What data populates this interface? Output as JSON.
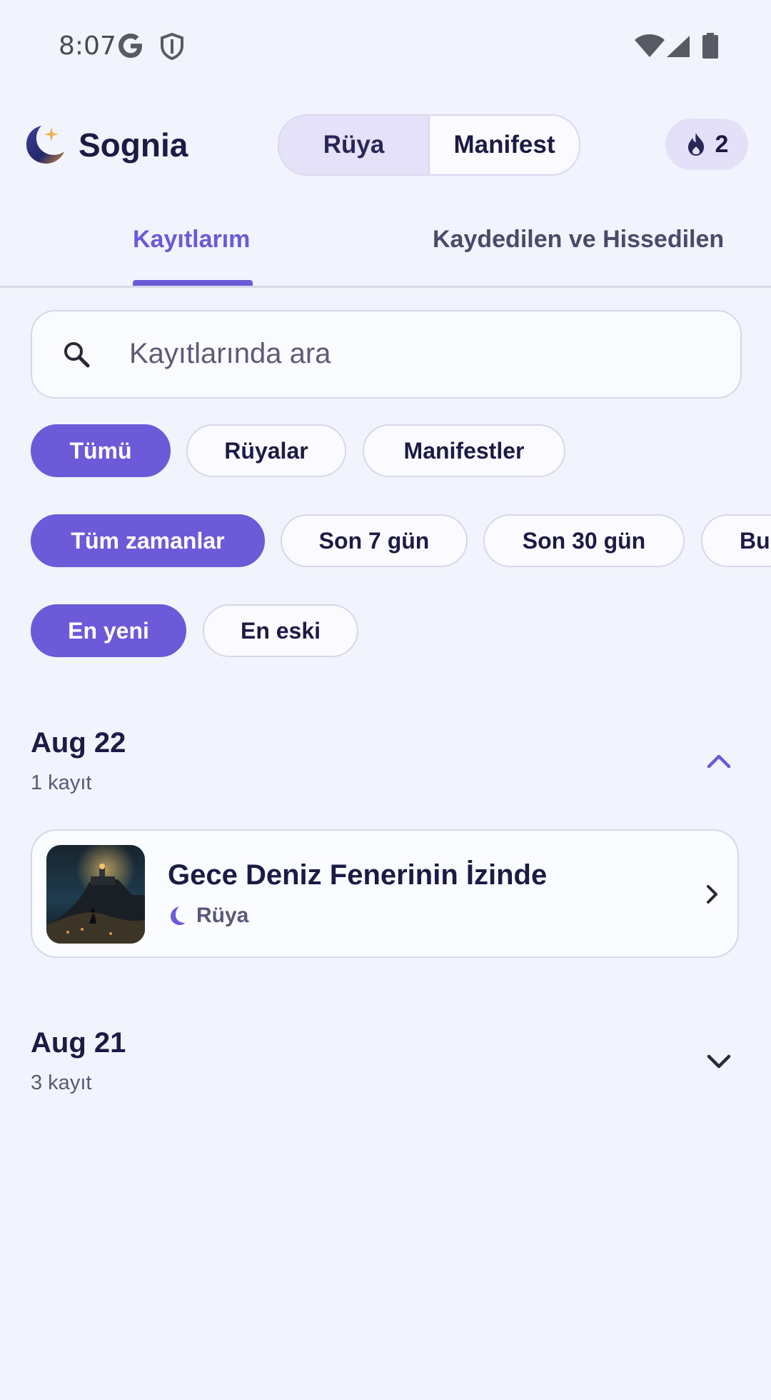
{
  "status_bar": {
    "time": "8:07",
    "icons": [
      "google-icon",
      "shield-icon",
      "wifi-icon",
      "cellular-icon",
      "battery-icon"
    ]
  },
  "header": {
    "title": "Sognia",
    "logo": "moon-star-logo",
    "mode_toggle": {
      "options": [
        "Rüya",
        "Manifest"
      ],
      "selected": "Rüya"
    },
    "streak": {
      "icon": "flame-icon",
      "count": "2"
    }
  },
  "tabs": [
    {
      "label": "Kayıtlarım",
      "active": true
    },
    {
      "label": "Kaydedilen ve Hissedilen",
      "active": false
    }
  ],
  "search": {
    "placeholder": "Kayıtlarında ara",
    "value": ""
  },
  "filters": {
    "type": [
      {
        "label": "Tümü",
        "active": true
      },
      {
        "label": "Rüyalar",
        "active": false
      },
      {
        "label": "Manifestler",
        "active": false
      }
    ],
    "time": [
      {
        "label": "Tüm zamanlar",
        "active": true
      },
      {
        "label": "Son 7 gün",
        "active": false
      },
      {
        "label": "Son 30 gün",
        "active": false
      },
      {
        "label": "Bu",
        "active": false
      }
    ],
    "sort": [
      {
        "label": "En yeni",
        "active": true
      },
      {
        "label": "En eski",
        "active": false
      }
    ]
  },
  "groups": [
    {
      "date": "Aug 22",
      "count": "1 kayıt",
      "expanded": true,
      "entries": [
        {
          "title": "Gece Deniz Fenerinin İzinde",
          "type": "Rüya",
          "type_icon": "moon-icon"
        }
      ]
    },
    {
      "date": "Aug 21",
      "count": "3 kayıt",
      "expanded": false,
      "entries": []
    }
  ],
  "colors": {
    "accent": "#6c5ad8",
    "background": "#f2f4fd",
    "text": "#1d1a45"
  }
}
